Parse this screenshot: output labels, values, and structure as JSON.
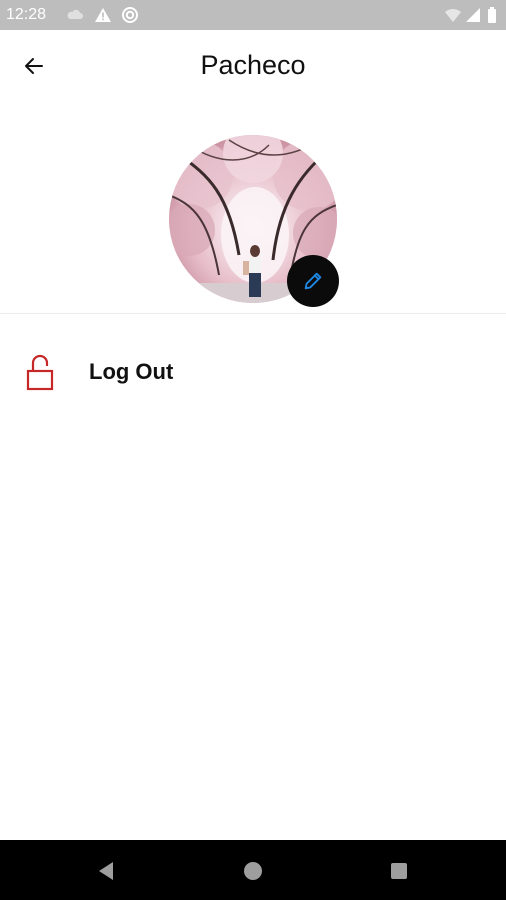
{
  "status_bar": {
    "time": "12:28",
    "icons": [
      "cloud-icon",
      "warning-icon",
      "sync-icon",
      "wifi-icon",
      "signal-icon",
      "battery-icon"
    ]
  },
  "app_bar": {
    "title": "Pacheco",
    "back_icon": "arrow-left-icon"
  },
  "profile": {
    "avatar_description_icon": "avatar",
    "edit_icon": "pencil-icon",
    "edit_icon_color": "#1e88e5"
  },
  "menu": {
    "items": [
      {
        "label": "Log Out",
        "icon": "unlocked-padlock-icon",
        "icon_color": "#c62828"
      }
    ]
  },
  "nav_bar": {
    "buttons": [
      "back-triangle-icon",
      "home-circle-icon",
      "recents-square-icon"
    ]
  },
  "colors": {
    "status_bar_bg": "#bdbdbd",
    "nav_bar_bg": "#000000",
    "edit_button_bg": "#0b0b0b"
  }
}
